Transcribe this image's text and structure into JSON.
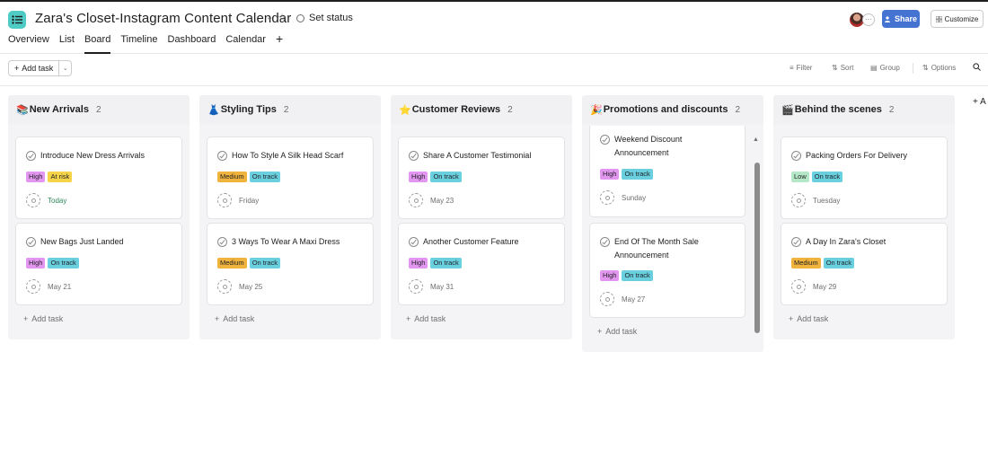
{
  "header": {
    "title": "Zara's Closet-Instagram Content Calendar",
    "set_status": "Set status",
    "tabs": [
      {
        "label": "Overview",
        "active": false
      },
      {
        "label": "List",
        "active": false
      },
      {
        "label": "Board",
        "active": true
      },
      {
        "label": "Timeline",
        "active": false
      },
      {
        "label": "Dashboard",
        "active": false
      },
      {
        "label": "Calendar",
        "active": false
      }
    ],
    "tab_add": "+",
    "share_label": "Share",
    "customize_label": "Customize",
    "more_avatars": "···"
  },
  "toolbar": {
    "add_task": "Add task",
    "filter": "Filter",
    "sort": "Sort",
    "group": "Group",
    "options": "Options"
  },
  "columns": [
    {
      "emoji": "📚",
      "name": "New Arrivals",
      "count": "2",
      "add_task": "Add task",
      "cards": [
        {
          "title": "Introduce New Dress Arrivals",
          "priority": "High",
          "status": "At risk",
          "due": "Today"
        },
        {
          "title": "New Bags Just Landed",
          "priority": "High",
          "status": "On track",
          "due": "May 21"
        }
      ]
    },
    {
      "emoji": "👗",
      "name": "Styling Tips",
      "count": "2",
      "add_task": "Add task",
      "cards": [
        {
          "title": "How To Style A Silk Head Scarf",
          "priority": "Medium",
          "status": "On track",
          "due": "Friday"
        },
        {
          "title": "3 Ways To Wear A Maxi Dress",
          "priority": "Medium",
          "status": "On track",
          "due": "May 25"
        }
      ]
    },
    {
      "emoji": "⭐",
      "name": "Customer Reviews",
      "count": "2",
      "add_task": "Add task",
      "cards": [
        {
          "title": "Share A Customer Testimonial",
          "priority": "High",
          "status": "On track",
          "due": "May 23"
        },
        {
          "title": "Another Customer Feature",
          "priority": "High",
          "status": "On track",
          "due": "May 31"
        }
      ]
    },
    {
      "emoji": "🎉",
      "name": "Promotions and discounts",
      "count": "2",
      "add_task": "Add task",
      "cards": [
        {
          "title_line1": "Weekend Discount",
          "title_line2": "Announcement",
          "priority": "High",
          "status": "On track",
          "due": "Sunday"
        },
        {
          "title_line1": "End Of The Month Sale",
          "title_line2": "Announcement",
          "priority": "High",
          "status": "On track",
          "due": "May 27"
        }
      ]
    },
    {
      "emoji": "🎬",
      "name": "Behind the scenes",
      "count": "2",
      "add_task": "Add task",
      "cards": [
        {
          "title": "Packing Orders For Delivery",
          "priority": "Low",
          "status": "On track",
          "due": "Tuesday"
        },
        {
          "title": "A Day In Zara's Closet",
          "priority": "Medium",
          "status": "On track",
          "due": "May 29"
        }
      ]
    }
  ],
  "add_section": "+ A",
  "colors": {
    "accent": "#4573d2",
    "project_icon": "#4ecbc4",
    "high": "#e296f0",
    "medium": "#f0b33d",
    "low": "#b4e7c6",
    "at_risk": "#f5d44a",
    "on_track": "#6ad0e0",
    "today": "#2e8a5a"
  },
  "icons": {
    "project": "list-icon",
    "chevron": "chevron-down-icon",
    "star": "star-icon",
    "check": "check-circle-icon",
    "assignee": "unassigned-avatar-icon"
  }
}
